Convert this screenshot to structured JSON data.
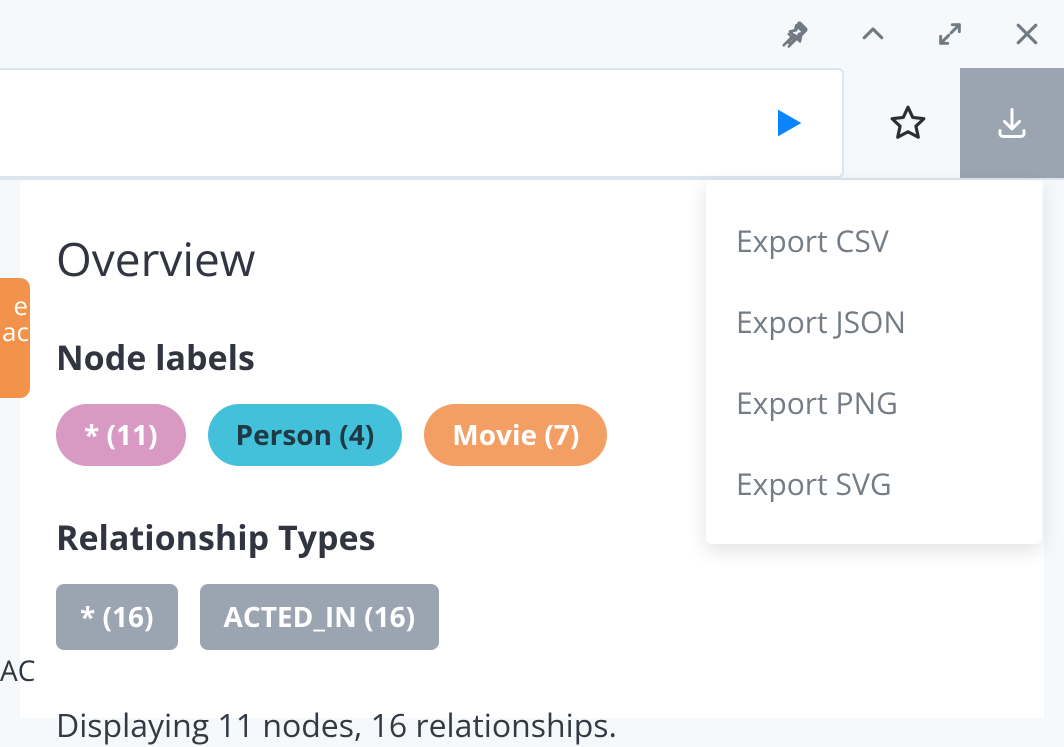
{
  "window_controls": {
    "pin": "pin-icon",
    "collapse": "chevron-up-icon",
    "expand": "expand-icon",
    "close": "close-icon"
  },
  "toolbar": {
    "run": "play-icon",
    "favorite": "star-icon",
    "download": "download-icon"
  },
  "export_menu": {
    "items": [
      "Export CSV",
      "Export JSON",
      "Export PNG",
      "Export SVG"
    ]
  },
  "overview": {
    "title": "Overview",
    "node_labels_heading": "Node labels",
    "node_labels": [
      {
        "text": "* (11)",
        "variant": "pink"
      },
      {
        "text": "Person (4)",
        "variant": "teal"
      },
      {
        "text": "Movie (7)",
        "variant": "orange"
      }
    ],
    "relationship_types_heading": "Relationship Types",
    "relationship_types": [
      {
        "text": "* (16)"
      },
      {
        "text": "ACTED_IN (16)"
      }
    ],
    "status": "Displaying 11 nodes, 16 relationships."
  },
  "fragments": {
    "left_badge_lines": "e\nac",
    "left_text": "AC"
  }
}
